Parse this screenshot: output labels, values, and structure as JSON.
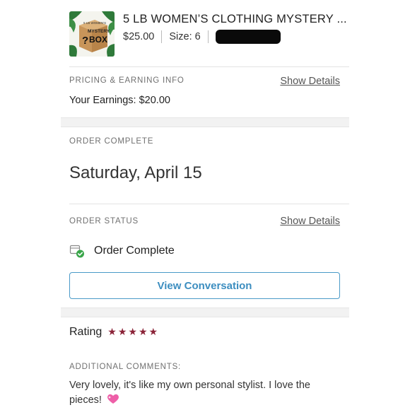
{
  "product": {
    "title": "5 LB WOMEN’S CLOTHING MYSTERY ...",
    "price": "$25.00",
    "size": "Size: 6",
    "thumb_text_top": "5 LB WOMEN'S",
    "thumb_text_mystery": "MYSTERY",
    "thumb_text_box": "BOX",
    "thumb_text_q": "?"
  },
  "pricing": {
    "label": "PRICING & EARNING INFO",
    "show_details": "Show Details",
    "earnings": "Your Earnings: $20.00"
  },
  "order_complete": {
    "label": "ORDER COMPLETE",
    "date": "Saturday, April 15"
  },
  "order_status": {
    "label": "ORDER STATUS",
    "show_details": "Show Details",
    "status": "Order Complete",
    "status_icon": "box-check-icon"
  },
  "actions": {
    "view_conversation": "View Conversation"
  },
  "rating": {
    "label": "Rating",
    "stars": 5,
    "star_color": "#8b2338"
  },
  "comments": {
    "label": "ADDITIONAL COMMENTS:",
    "text": "Very lovely, it's like my own personal stylist. I love the pieces!"
  },
  "colors": {
    "link_blue": "#3d8ec0",
    "check_green": "#3aa64a"
  }
}
